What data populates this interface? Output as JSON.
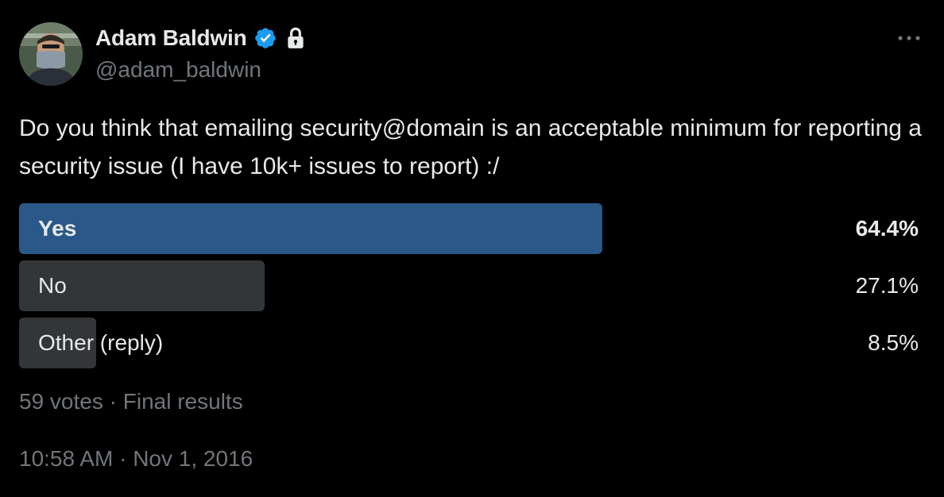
{
  "author": {
    "display_name": "Adam Baldwin",
    "handle": "@adam_baldwin",
    "verified_icon": "verified-badge-icon",
    "protected_icon": "lock-icon",
    "avatar_icon": "avatar-photo"
  },
  "more_icon": "more-options-icon",
  "tweet": {
    "text": "Do you think that emailing security@domain is an acceptable minimum for reporting a security issue (I have 10k+ issues to report) :/"
  },
  "poll": {
    "options": [
      {
        "label": "Yes",
        "percent_label": "64.4%",
        "percent": 64.4,
        "winner": true
      },
      {
        "label": "No",
        "percent_label": "27.1%",
        "percent": 27.1,
        "winner": false
      },
      {
        "label": "Other (reply)",
        "percent_label": "8.5%",
        "percent": 8.5,
        "winner": false
      }
    ],
    "votes": "59 votes",
    "separator": "·",
    "status": "Final results"
  },
  "timestamp": {
    "time": "10:58 AM",
    "separator": "·",
    "date": "Nov 1, 2016"
  },
  "colors": {
    "background": "#000000",
    "text": "#e7e9ea",
    "muted": "#71767b",
    "winner_bar": "#2a5889",
    "bar": "#333639",
    "verified": "#1d9bf0"
  }
}
